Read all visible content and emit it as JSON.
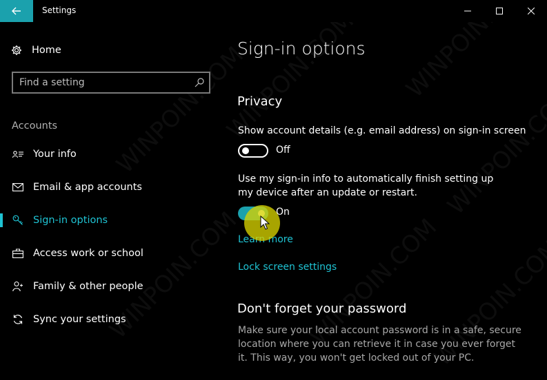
{
  "window": {
    "title": "Settings",
    "icons": {
      "back": "back-arrow-icon",
      "minimize": "minimize-icon",
      "maximize": "maximize-icon",
      "close": "close-icon"
    }
  },
  "sidebar": {
    "home_label": "Home",
    "search_placeholder": "Find a setting",
    "section_label": "Accounts",
    "items": [
      {
        "label": "Your info",
        "icon": "contact-card-icon",
        "active": false
      },
      {
        "label": "Email & app accounts",
        "icon": "mail-icon",
        "active": false
      },
      {
        "label": "Sign-in options",
        "icon": "key-icon",
        "active": true
      },
      {
        "label": "Access work or school",
        "icon": "briefcase-icon",
        "active": false
      },
      {
        "label": "Family & other people",
        "icon": "people-icon",
        "active": false
      },
      {
        "label": "Sync your settings",
        "icon": "sync-icon",
        "active": false
      }
    ]
  },
  "main": {
    "page_title": "Sign-in options",
    "privacy": {
      "heading": "Privacy",
      "setting1": {
        "description": "Show account details (e.g. email address) on sign-in screen",
        "state_label": "Off",
        "on": false
      },
      "setting2": {
        "description": "Use my sign-in info to automatically finish setting up my device after an update or restart.",
        "state_label": "On",
        "on": true
      },
      "learn_more": "Learn more",
      "lock_screen_link": "Lock screen settings"
    },
    "password": {
      "heading": "Don't forget your password",
      "body": "Make sure your local account password is in a safe, secure location where you can retrieve it in case you ever forget it. This way, you won't get locked out of your PC."
    }
  },
  "watermark": {
    "text": "WINPOIN.COM"
  },
  "colors": {
    "accent": "#1fc3d3",
    "back_button": "#1ba1ad",
    "toggle_on": "#1ba1ad",
    "cursor_highlight": "#d7d200",
    "background": "#000000"
  }
}
